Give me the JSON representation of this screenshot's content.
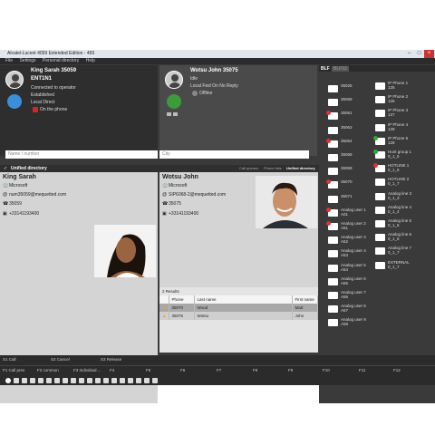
{
  "window": {
    "title": "Alcatel-Lucent 4059 Extended Edition - 469"
  },
  "menu": [
    "File",
    "Settings",
    "Personal directory",
    "Help"
  ],
  "call_left": {
    "name": "King Sarah 35059",
    "line": "ENT1N1",
    "status1": "Connected to operator",
    "status2": "Established",
    "status3": "Local Direct",
    "hold": "On the phone"
  },
  "call_right": {
    "name": "Wotsu John 35075",
    "status1": "Idle",
    "status2": "Local Fwd On No Reply",
    "presence": "Offline"
  },
  "search": {
    "name_placeholder": "Name / number",
    "city_placeholder": "City"
  },
  "directory": {
    "left_tab": "Unified directory",
    "right_tabs": [
      "Call queues",
      "Phone lists",
      "Unified directory"
    ]
  },
  "contact_left": {
    "name": "King Sarah",
    "company": "Microsoft",
    "email": "num35059@mequetted.com",
    "phone": "35059",
    "mobile": "+33141193400"
  },
  "contact_right": {
    "name": "Wotsu John",
    "company": "Microsoft",
    "email": "SIP6068-2@mequetted.com",
    "phone": "35075",
    "mobile": "+33141193400"
  },
  "results": {
    "count_label": "2 Results",
    "headers": [
      "Phone",
      "Last name",
      "First name"
    ],
    "rows": [
      {
        "phone": "35070",
        "last": "Wood",
        "first": "Matt"
      },
      {
        "phone": "35075",
        "last": "Wotsu",
        "first": "John"
      }
    ]
  },
  "blf": {
    "tabs": [
      "BLF",
      "BLF02"
    ],
    "left": [
      {
        "label": "35025",
        "status": "none"
      },
      {
        "label": "35059",
        "status": "none"
      },
      {
        "label": "35061",
        "status": "red"
      },
      {
        "label": "35063",
        "status": "none"
      },
      {
        "label": "35064",
        "status": "red"
      },
      {
        "label": "35068",
        "status": "none"
      },
      {
        "label": "35069",
        "status": "none"
      },
      {
        "label": "35070",
        "status": "red"
      },
      {
        "label": "35071",
        "status": "none"
      },
      {
        "label": "Analog user 1\nA01",
        "status": "red"
      },
      {
        "label": "Analog user 2\nA51",
        "status": "red"
      },
      {
        "label": "Analog user 3\nA52",
        "status": "none"
      },
      {
        "label": "Analog user 4\nA53",
        "status": "none"
      },
      {
        "label": "Analog user 5\nA54",
        "status": "none"
      },
      {
        "label": "Analog user 6\nA55",
        "status": "none"
      },
      {
        "label": "Analog user 7\nA56",
        "status": "none"
      },
      {
        "label": "Analog user 8\nA57",
        "status": "none"
      },
      {
        "label": "Analog user 9\nA58",
        "status": "none"
      }
    ],
    "right": [
      {
        "label": "IP Phone 1\n125",
        "status": "none"
      },
      {
        "label": "IP Phone 2\n126",
        "status": "none"
      },
      {
        "label": "IP Phone 3\n127",
        "status": "none"
      },
      {
        "label": "IP Phone 4\n128",
        "status": "none"
      },
      {
        "label": "IP Phone 5\n129",
        "status": "grn"
      },
      {
        "label": "Hunt group 1\n0_1_5",
        "status": "grn"
      },
      {
        "label": "HOTLINE 1\n0_1_6",
        "status": "red"
      },
      {
        "label": "HOTLINE 2\n0_1_7",
        "status": "none"
      },
      {
        "label": "Analog line 3\n0_1_3",
        "status": "none"
      },
      {
        "label": "Analog line 4\n0_1_4",
        "status": "none"
      },
      {
        "label": "Analog line 5\n0_1_5",
        "status": "none"
      },
      {
        "label": "Analog line 6\n0_1_6",
        "status": "none"
      },
      {
        "label": "Analog line 7\n0_1_7",
        "status": "none"
      },
      {
        "label": "EXTERNAL\n0_1_7",
        "status": "none"
      }
    ]
  },
  "softkeys": [
    "S1 Call",
    "S2 Cancel",
    "S3 Release"
  ],
  "fkeys": [
    "F1 Call pres",
    "F2 common",
    "F3 Individual ...",
    "F4",
    "F5",
    "F6",
    "F7",
    "F8",
    "F9",
    "F10",
    "F11",
    "F12"
  ],
  "icon_names": [
    "record-icon",
    "phone-icon",
    "people-icon",
    "mic-icon",
    "speaker-icon",
    "volume-icon",
    "arrow-left-icon",
    "arrow-right-icon",
    "keypad-icon",
    "chat-icon",
    "hold-icon",
    "transfer-icon",
    "conference-icon",
    "park-icon",
    "mail-icon",
    "camera-icon",
    "settings-icon",
    "help-icon",
    "edit-icon"
  ]
}
